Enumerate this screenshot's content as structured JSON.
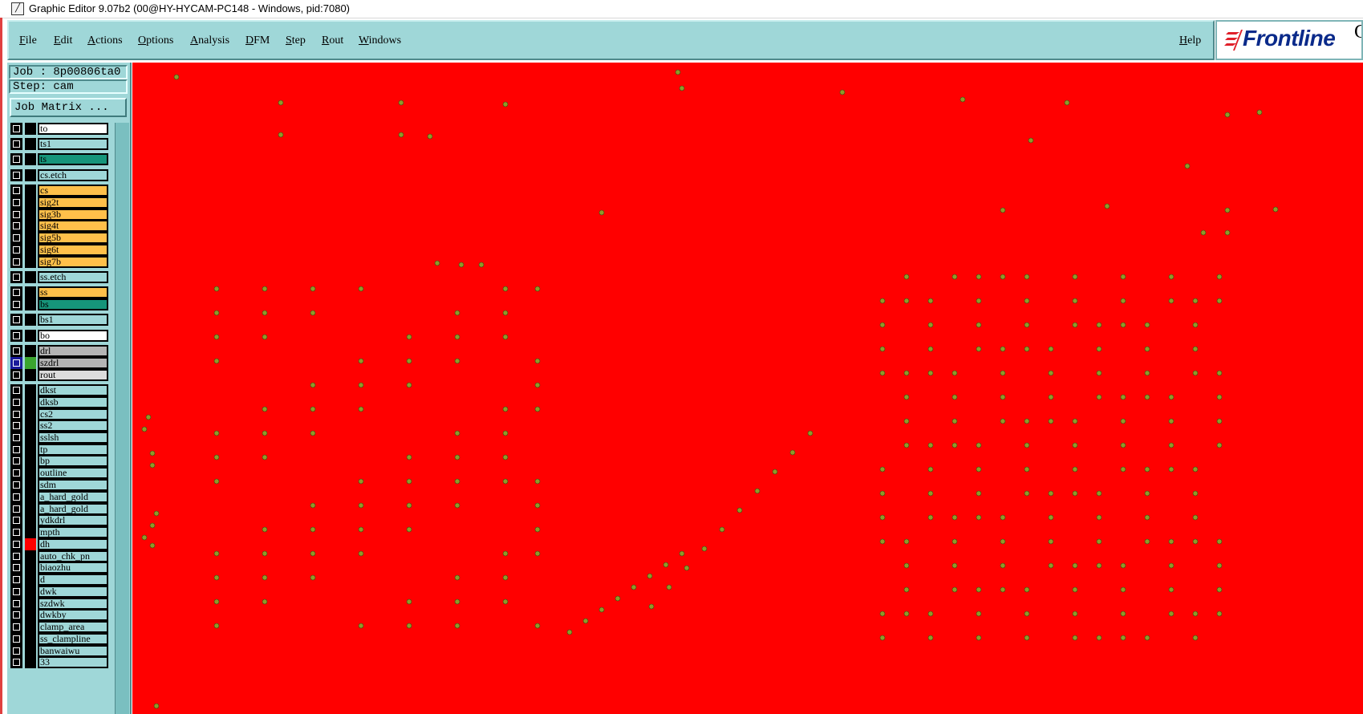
{
  "window": {
    "title": "Graphic Editor 9.07b2 (00@HY-HYCAM-PC148 - Windows, pid:7080)"
  },
  "menu": {
    "file": "File",
    "edit": "Edit",
    "actions": "Actions",
    "options": "Options",
    "analysis": "Analysis",
    "dfm": "DFM",
    "step": "Step",
    "rout": "Rout",
    "windows": "Windows",
    "help": "Help"
  },
  "logo": {
    "text": "Frontline",
    "trailing": "G"
  },
  "job": {
    "label": "Job : 8p00806ta0",
    "step": "Step: cam",
    "matrix_button": "Job Matrix ..."
  },
  "layers": [
    {
      "name": "to",
      "color": "#ffffff",
      "swatch": "#000000"
    },
    {
      "name": "ts1",
      "color": "#9fd7d8",
      "swatch": "#000000"
    },
    {
      "name": "ts",
      "color": "#16957a",
      "swatch": "#000000"
    },
    {
      "name": "cs.etch",
      "color": "#9fd7d8",
      "swatch": "#000000"
    },
    {
      "name": "cs",
      "color": "#ffc04a",
      "swatch": "#000000"
    },
    {
      "name": "sig2t",
      "color": "#ffc04a",
      "swatch": "#000000"
    },
    {
      "name": "sig3b",
      "color": "#ffc04a",
      "swatch": "#000000"
    },
    {
      "name": "sig4t",
      "color": "#ffc04a",
      "swatch": "#000000"
    },
    {
      "name": "sig5b",
      "color": "#ffc04a",
      "swatch": "#000000"
    },
    {
      "name": "sig6t",
      "color": "#ffc04a",
      "swatch": "#000000"
    },
    {
      "name": "sig7b",
      "color": "#ffc04a",
      "swatch": "#000000"
    },
    {
      "name": "ss.etch",
      "color": "#9fd7d8",
      "swatch": "#000000"
    },
    {
      "name": "ss",
      "color": "#ffc04a",
      "swatch": "#000000"
    },
    {
      "name": "bs",
      "color": "#16957a",
      "swatch": "#000000"
    },
    {
      "name": "bs1",
      "color": "#9fd7d8",
      "swatch": "#000000"
    },
    {
      "name": "bo",
      "color": "#ffffff",
      "swatch": "#000000"
    },
    {
      "name": "drl",
      "color": "#b4b4b4",
      "swatch": "#000000"
    },
    {
      "name": "szdrl",
      "color": "#b4b4b4",
      "swatch": "#3aa52e",
      "active": true
    },
    {
      "name": "rout",
      "color": "#dcdcdc",
      "swatch": "#000000"
    },
    {
      "name": "dkst",
      "color": "#9fd7d8",
      "swatch": "#000000"
    },
    {
      "name": "dksb",
      "color": "#9fd7d8",
      "swatch": "#000000"
    },
    {
      "name": "cs2",
      "color": "#9fd7d8",
      "swatch": "#000000"
    },
    {
      "name": "ss2",
      "color": "#9fd7d8",
      "swatch": "#000000"
    },
    {
      "name": "sslsh",
      "color": "#9fd7d8",
      "swatch": "#000000"
    },
    {
      "name": "tp",
      "color": "#9fd7d8",
      "swatch": "#000000"
    },
    {
      "name": "bp",
      "color": "#9fd7d8",
      "swatch": "#000000"
    },
    {
      "name": "outline",
      "color": "#9fd7d8",
      "swatch": "#000000"
    },
    {
      "name": "sdm",
      "color": "#9fd7d8",
      "swatch": "#000000"
    },
    {
      "name": "a_hard_gold",
      "color": "#9fd7d8",
      "swatch": "#000000"
    },
    {
      "name": "a_hard_gold",
      "color": "#9fd7d8",
      "swatch": "#000000"
    },
    {
      "name": "ydkdrl",
      "color": "#9fd7d8",
      "swatch": "#000000"
    },
    {
      "name": "mpth",
      "color": "#9fd7d8",
      "swatch": "#000000"
    },
    {
      "name": "dh",
      "color": "#9fd7d8",
      "swatch": "#ff0000"
    },
    {
      "name": "auto_chk_pn",
      "color": "#9fd7d8",
      "swatch": "#000000"
    },
    {
      "name": "biaozhu",
      "color": "#9fd7d8",
      "swatch": "#000000"
    },
    {
      "name": "d",
      "color": "#9fd7d8",
      "swatch": "#000000"
    },
    {
      "name": "dwk",
      "color": "#9fd7d8",
      "swatch": "#000000"
    },
    {
      "name": "szdwk",
      "color": "#9fd7d8",
      "swatch": "#000000"
    },
    {
      "name": "dwkby",
      "color": "#9fd7d8",
      "swatch": "#000000"
    },
    {
      "name": "clamp_area",
      "color": "#9fd7d8",
      "swatch": "#000000"
    },
    {
      "name": "ss_clampline",
      "color": "#9fd7d8",
      "swatch": "#000000"
    },
    {
      "name": "banwaiwu",
      "color": "#9fd7d8",
      "swatch": "#000000"
    },
    {
      "name": "33",
      "color": "#9fd7d8",
      "swatch": "#000000"
    }
  ],
  "canvas": {
    "background": "#ff0000",
    "pad_color": "#8f9a2a"
  }
}
